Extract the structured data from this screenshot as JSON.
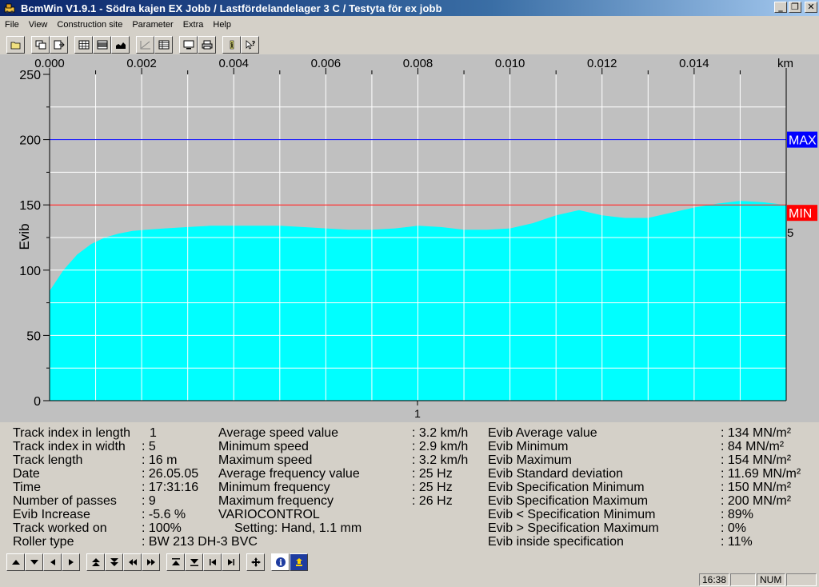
{
  "window": {
    "title": "BcmWin V1.9.1 - Södra kajen EX Jobb / Lastfördelandelager 3 C / Testyta för ex jobb",
    "controls": [
      "minimize",
      "restore",
      "close"
    ]
  },
  "menu": {
    "items": [
      "File",
      "View",
      "Construction site",
      "Parameter",
      "Extra",
      "Help"
    ]
  },
  "toolbar_top": {
    "buttons": [
      "open-icon",
      "copy-window-icon",
      "export-icon",
      "grid-icon",
      "bars-icon",
      "area-chart-icon",
      "line-chart-icon",
      "table-icon",
      "monitor-icon",
      "print-icon",
      "info-icon",
      "help-cursor-icon"
    ]
  },
  "toolbar_bottom": {
    "buttons": [
      "arrow-up-icon",
      "arrow-down-icon",
      "arrow-left-icon",
      "arrow-right-icon",
      "first-up-icon",
      "last-down-icon",
      "rewind-icon",
      "fast-forward-icon",
      "top-icon",
      "bottom-icon",
      "first-icon",
      "last-icon",
      "move-icon",
      "info-icon",
      "highlight-icon"
    ]
  },
  "chart_data": {
    "type": "area",
    "x_unit": "km",
    "ylabel": "Evib",
    "xlim": [
      0,
      0.016
    ],
    "ylim": [
      0,
      250
    ],
    "x_ticks": [
      "0.000",
      "0.002",
      "0.004",
      "0.006",
      "0.008",
      "0.010",
      "0.012",
      "0.014"
    ],
    "x_tick_values": [
      0,
      0.002,
      0.004,
      0.006,
      0.008,
      0.01,
      0.012,
      0.014
    ],
    "y_ticks": [
      "0",
      "50",
      "100",
      "150",
      "200",
      "250"
    ],
    "y_tick_values": [
      0,
      50,
      100,
      150,
      200,
      250
    ],
    "grid": true,
    "track_label": "1",
    "max_line": {
      "label": "MAX",
      "value": 200,
      "color": "#0000ff"
    },
    "min_line": {
      "label": "MIN",
      "value": 150,
      "color": "#ff0000"
    },
    "right_marker": "5",
    "fill_color": "#00ffff",
    "x": [
      0,
      0.0003,
      0.0006,
      0.0009,
      0.0012,
      0.0015,
      0.0018,
      0.0021,
      0.0025,
      0.003,
      0.0035,
      0.004,
      0.0045,
      0.005,
      0.0055,
      0.006,
      0.0065,
      0.007,
      0.0075,
      0.008,
      0.0085,
      0.009,
      0.0095,
      0.01,
      0.0105,
      0.011,
      0.0115,
      0.012,
      0.0125,
      0.013,
      0.0135,
      0.014,
      0.0145,
      0.015,
      0.0155,
      0.016
    ],
    "values": [
      84,
      100,
      112,
      120,
      125,
      128,
      130,
      131,
      132,
      133,
      134,
      134,
      134,
      134,
      133,
      132,
      131,
      131,
      132,
      134,
      133,
      131,
      131,
      132,
      136,
      142,
      146,
      142,
      140,
      140,
      144,
      148,
      151,
      153,
      152,
      150
    ]
  },
  "stats": {
    "col1": [
      {
        "label": "Track index in length",
        "value": "1"
      },
      {
        "label": "Track index in width",
        "value": ": 5"
      },
      {
        "label": "Track length",
        "value": ": 16 m"
      },
      {
        "label": "Date",
        "value": ": 26.05.05"
      },
      {
        "label": "Time",
        "value": ": 17:31:16"
      },
      {
        "label": "Number of passes",
        "value": ": 9"
      },
      {
        "label": "Evib Increase",
        "value": ": -5.6 %"
      },
      {
        "label": "Track worked on",
        "value": ": 100%"
      },
      {
        "label": "Roller type",
        "value": ": BW 213 DH-3 BVC"
      }
    ],
    "col2": [
      {
        "label": "Average speed value",
        "value": ": 3.2 km/h"
      },
      {
        "label": "Minimum speed",
        "value": ": 2.9 km/h"
      },
      {
        "label": "Maximum speed",
        "value": ": 3.2 km/h"
      },
      {
        "label": "Average frequency value",
        "value": ": 25 Hz"
      },
      {
        "label": "Minimum frequency",
        "value": ": 25 Hz"
      },
      {
        "label": "Maximum frequency",
        "value": ": 26 Hz"
      },
      {
        "label": "VARIOCONTROL",
        "value": ""
      },
      {
        "label": "Setting: Hand, 1.1 mm",
        "value": ""
      }
    ],
    "col3": [
      {
        "label": "Evib Average value",
        "value": ": 134 MN/m²"
      },
      {
        "label": "Evib Minimum",
        "value": ": 84 MN/m²"
      },
      {
        "label": "Evib Maximum",
        "value": ": 154 MN/m²"
      },
      {
        "label": "Evib Standard deviation",
        "value": ": 11.69 MN/m²"
      },
      {
        "label": "Evib Specification Minimum",
        "value": ": 150 MN/m²"
      },
      {
        "label": "Evib Specification Maximum",
        "value": ": 200 MN/m²"
      },
      {
        "label": "Evib < Specification Minimum",
        "value": ": 89%"
      },
      {
        "label": "Evib > Specification Maximum",
        "value": ": 0%"
      },
      {
        "label": "Evib inside specification",
        "value": ": 11%"
      }
    ]
  },
  "statusbar": {
    "time": "16:38",
    "num": "NUM"
  }
}
